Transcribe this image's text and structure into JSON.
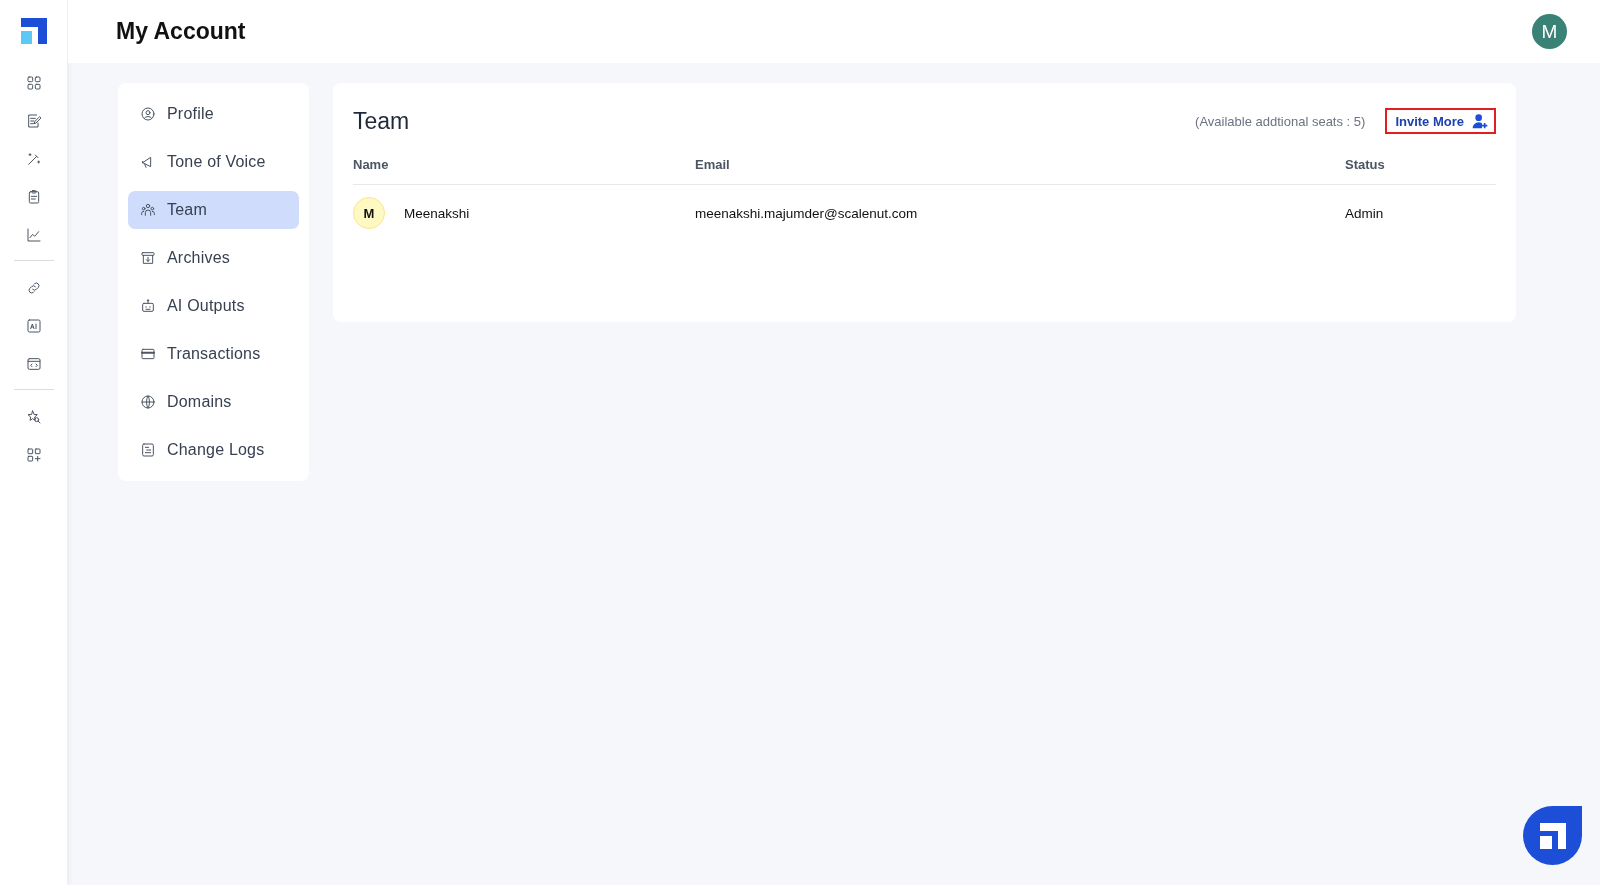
{
  "header": {
    "title": "My Account",
    "avatar": "M"
  },
  "menu": [
    {
      "label": "Profile",
      "selected": false
    },
    {
      "label": "Tone of Voice",
      "selected": false
    },
    {
      "label": "Team",
      "selected": true
    },
    {
      "label": "Archives",
      "selected": false
    },
    {
      "label": "AI Outputs",
      "selected": false
    },
    {
      "label": "Transactions",
      "selected": false
    },
    {
      "label": "Domains",
      "selected": false
    },
    {
      "label": "Change Logs",
      "selected": false
    }
  ],
  "team": {
    "title": "Team",
    "seats": "(Available addtional seats : 5)",
    "invite_button": "Invite More",
    "columns": [
      "Name",
      "Email",
      "Status"
    ],
    "rows": [
      {
        "avatar": "M",
        "name": "Meenakshi",
        "email": "meenakshi.majumder@scalenut.com",
        "status": "Admin"
      }
    ]
  }
}
